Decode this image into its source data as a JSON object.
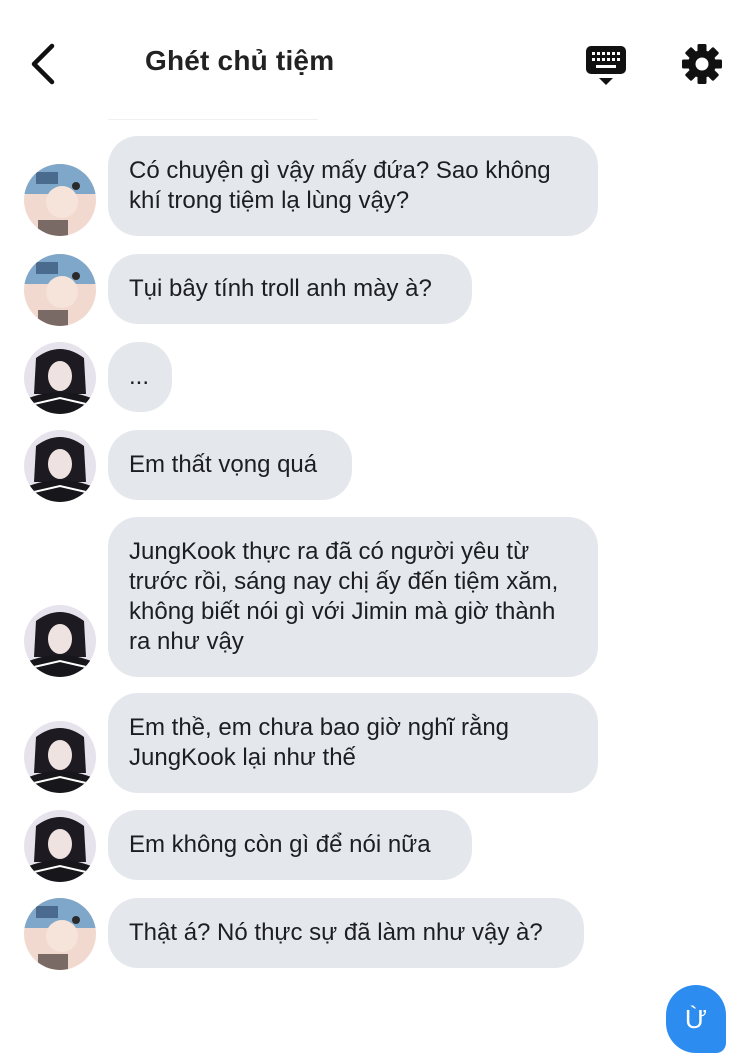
{
  "header": {
    "title": "Ghét chủ tiệm",
    "back_icon": "chevron-left-icon",
    "keyboard_icon": "keyboard-icon",
    "settings_icon": "gear-icon"
  },
  "colors": {
    "bubble": "#e4e7ec",
    "accent": "#2d8cf0",
    "text": "#1c1e21"
  },
  "messages": [
    {
      "sender": "avatar-a",
      "text": "Có chuyện gì vậy mấy đứa? Sao không khí trong tiệm lạ lùng vậy?"
    },
    {
      "sender": "avatar-a",
      "text": "Tụi bây tính troll anh mày à?"
    },
    {
      "sender": "avatar-b",
      "text": "..."
    },
    {
      "sender": "avatar-b",
      "text": "Em thất vọng quá"
    },
    {
      "sender": "avatar-b",
      "text": "JungKook thực ra đã có người yêu từ trước rồi, sáng nay chị ấy đến tiệm xăm, không biết nói gì với Jimin mà giờ thành ra như vậy"
    },
    {
      "sender": "avatar-b",
      "text": "Em thề, em chưa bao giờ nghĩ rằng JungKook lại như thế"
    },
    {
      "sender": "avatar-b",
      "text": "Em không còn gì để nói nữa"
    },
    {
      "sender": "avatar-a",
      "text": "Thật á? Nó thực sự đã làm như vậy à?"
    }
  ],
  "reply": {
    "label": "Ừ"
  }
}
